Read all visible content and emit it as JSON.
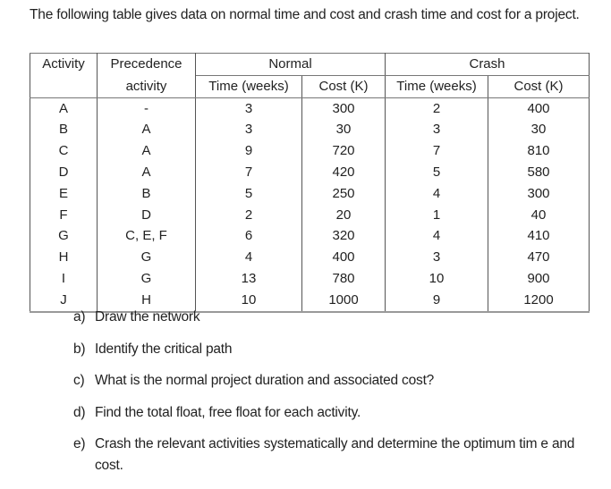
{
  "intro": "The following table gives data on normal time and cost and crash time and cost for a project.",
  "table": {
    "headers": {
      "activity": "Activity",
      "precedence_line1": "Precedence",
      "precedence_line2": "activity",
      "normal": "Normal",
      "crash": "Crash",
      "normal_time": "Time (weeks)",
      "normal_cost": "Cost (K)",
      "crash_time": "Time (weeks)",
      "crash_cost": "Cost (K)"
    },
    "rows": [
      {
        "activity": "A",
        "precedence": "-",
        "normal_time": "3",
        "normal_cost": "300",
        "crash_time": "2",
        "crash_cost": "400"
      },
      {
        "activity": "B",
        "precedence": "A",
        "normal_time": "3",
        "normal_cost": "30",
        "crash_time": "3",
        "crash_cost": "30"
      },
      {
        "activity": "C",
        "precedence": "A",
        "normal_time": "9",
        "normal_cost": "720",
        "crash_time": "7",
        "crash_cost": "810"
      },
      {
        "activity": "D",
        "precedence": "A",
        "normal_time": "7",
        "normal_cost": "420",
        "crash_time": "5",
        "crash_cost": "580"
      },
      {
        "activity": "E",
        "precedence": "B",
        "normal_time": "5",
        "normal_cost": "250",
        "crash_time": "4",
        "crash_cost": "300"
      },
      {
        "activity": "F",
        "precedence": "D",
        "normal_time": "2",
        "normal_cost": "20",
        "crash_time": "1",
        "crash_cost": "40"
      },
      {
        "activity": "G",
        "precedence": "C, E, F",
        "normal_time": "6",
        "normal_cost": "320",
        "crash_time": "4",
        "crash_cost": "410"
      },
      {
        "activity": "H",
        "precedence": "G",
        "normal_time": "4",
        "normal_cost": "400",
        "crash_time": "3",
        "crash_cost": "470"
      },
      {
        "activity": "I",
        "precedence": "G",
        "normal_time": "13",
        "normal_cost": "780",
        "crash_time": "10",
        "crash_cost": "900"
      },
      {
        "activity": "J",
        "precedence": "H",
        "normal_time": "10",
        "normal_cost": "1000",
        "crash_time": "9",
        "crash_cost": "1200"
      }
    ]
  },
  "questions": [
    {
      "label": "a)",
      "text": "Draw the network"
    },
    {
      "label": "b)",
      "text": "Identify the critical path"
    },
    {
      "label": "c)",
      "text": "What is the normal project duration and associated cost?"
    },
    {
      "label": "d)",
      "text": "Find the total float, free float for each activity."
    },
    {
      "label": "e)",
      "text": "Crash the relevant activities systematically and determine the optimum tim e and cost."
    }
  ]
}
